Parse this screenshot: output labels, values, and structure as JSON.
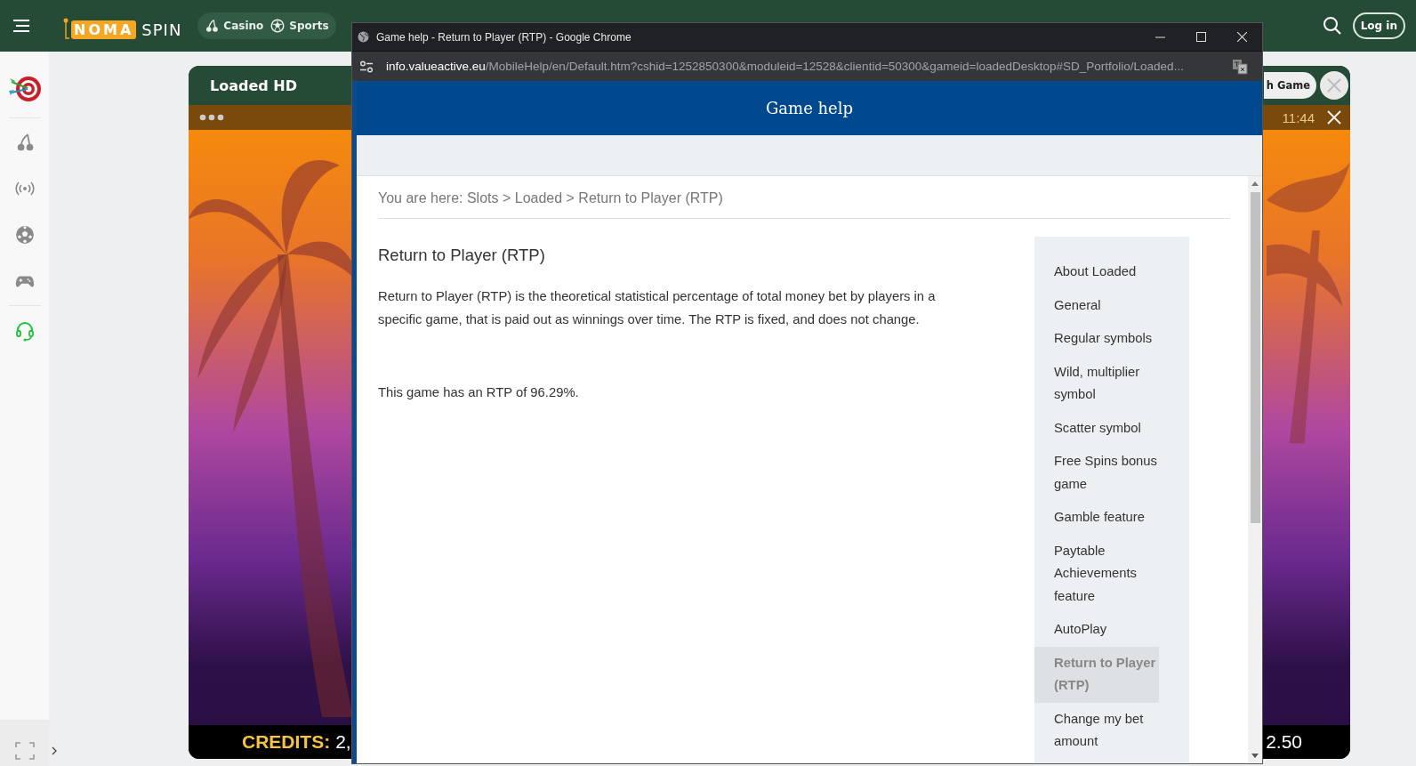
{
  "header": {
    "logo_mark": "NOMA",
    "logo_text": "SPIN",
    "nav": [
      {
        "label": "Casino",
        "kind": "casino"
      },
      {
        "label": "Sports",
        "kind": "sports"
      }
    ],
    "login": "Log in"
  },
  "game": {
    "title": "Loaded HD",
    "pill": "h Game",
    "time": "11:44",
    "credits_label": "CREDITS:",
    "credits_value": "2,",
    "bet_value": "2.50"
  },
  "popup": {
    "title": "Game help - Return to Player (RTP) - Google Chrome",
    "url_host": "info.valueactive.eu",
    "url_path": "/MobileHelp/en/Default.htm?cshid=1252850300&moduleid=12528&clientid=50300&gameid=loadedDesktop#SD_Portfolio/Loaded...",
    "page_title": "Game help",
    "breadcrumb": "You are here: Slots > Loaded > Return to Player (RTP)",
    "heading": "Return to Player (RTP)",
    "paragraphs": [
      "Return to Player (RTP) is the theoretical statistical percentage of total money bet by players in a specific game, that is paid out as winnings over time. The RTP is fixed, and does not change.",
      "This game has an RTP of 96.29%."
    ],
    "nav": [
      {
        "label": "About Loaded",
        "selected": false
      },
      {
        "label": "General",
        "selected": false
      },
      {
        "label": "Regular symbols",
        "selected": false
      },
      {
        "label": "Wild, multiplier symbol",
        "selected": false
      },
      {
        "label": "Scatter symbol",
        "selected": false
      },
      {
        "label": "Free Spins bonus game",
        "selected": false
      },
      {
        "label": "Gamble feature",
        "selected": false
      },
      {
        "label": "Paytable Achievements feature",
        "selected": false
      },
      {
        "label": "AutoPlay",
        "selected": false
      },
      {
        "label": "Return to Player (RTP)",
        "selected": true
      },
      {
        "label": "Change my bet amount",
        "selected": false
      }
    ]
  }
}
